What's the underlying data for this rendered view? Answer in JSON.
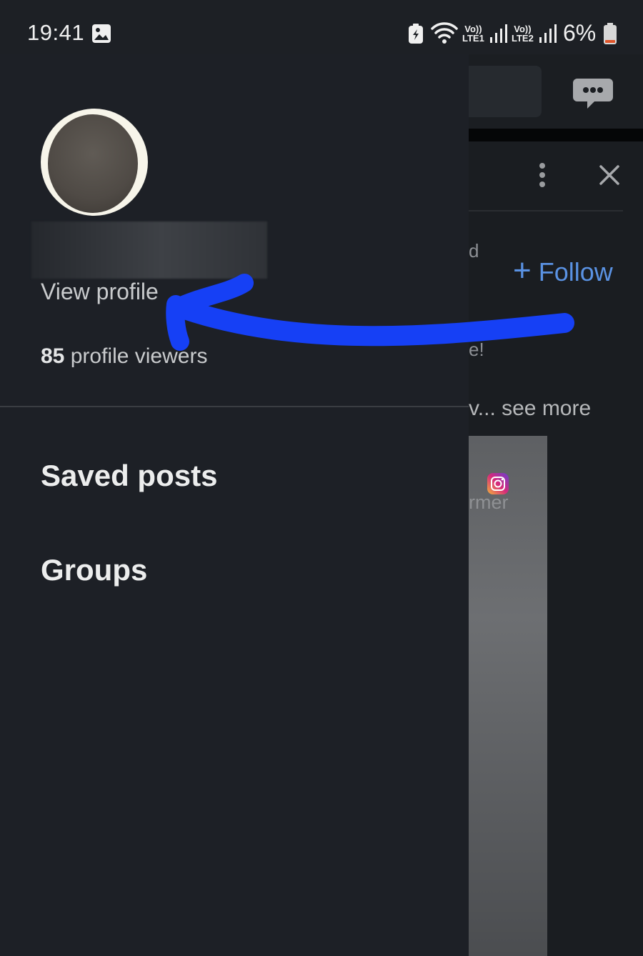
{
  "status_bar": {
    "time": "19:41",
    "sim1_top": "Vo))",
    "sim1_bottom": "LTE1",
    "sim2_top": "Vo))",
    "sim2_bottom": "LTE2",
    "battery_percent": "6%"
  },
  "drawer": {
    "view_profile_label": "View profile",
    "profile_viewers_count": "85",
    "profile_viewers_label": "profile viewers",
    "nav_items": [
      {
        "label": "Saved posts"
      },
      {
        "label": "Groups"
      }
    ]
  },
  "background_feed": {
    "follow_icon": "+",
    "follow_label": "Follow",
    "fragment_1": "d",
    "fragment_2": "e!",
    "see_more_text": "v... see more",
    "image_fragment_text": "rmer"
  },
  "icons": {
    "gallery": "gallery-icon",
    "battery_saver": "battery-saver-icon",
    "wifi": "wifi-icon",
    "signal": "signal-icon",
    "messages": "messages-icon",
    "more": "more-vertical-icon",
    "close": "close-icon",
    "instagram": "instagram-icon"
  },
  "colors": {
    "drawer_bg": "#1d2026",
    "accent_blue": "#5a92e3",
    "annotation_blue": "#1640f5",
    "battery_low": "#e0552a"
  }
}
